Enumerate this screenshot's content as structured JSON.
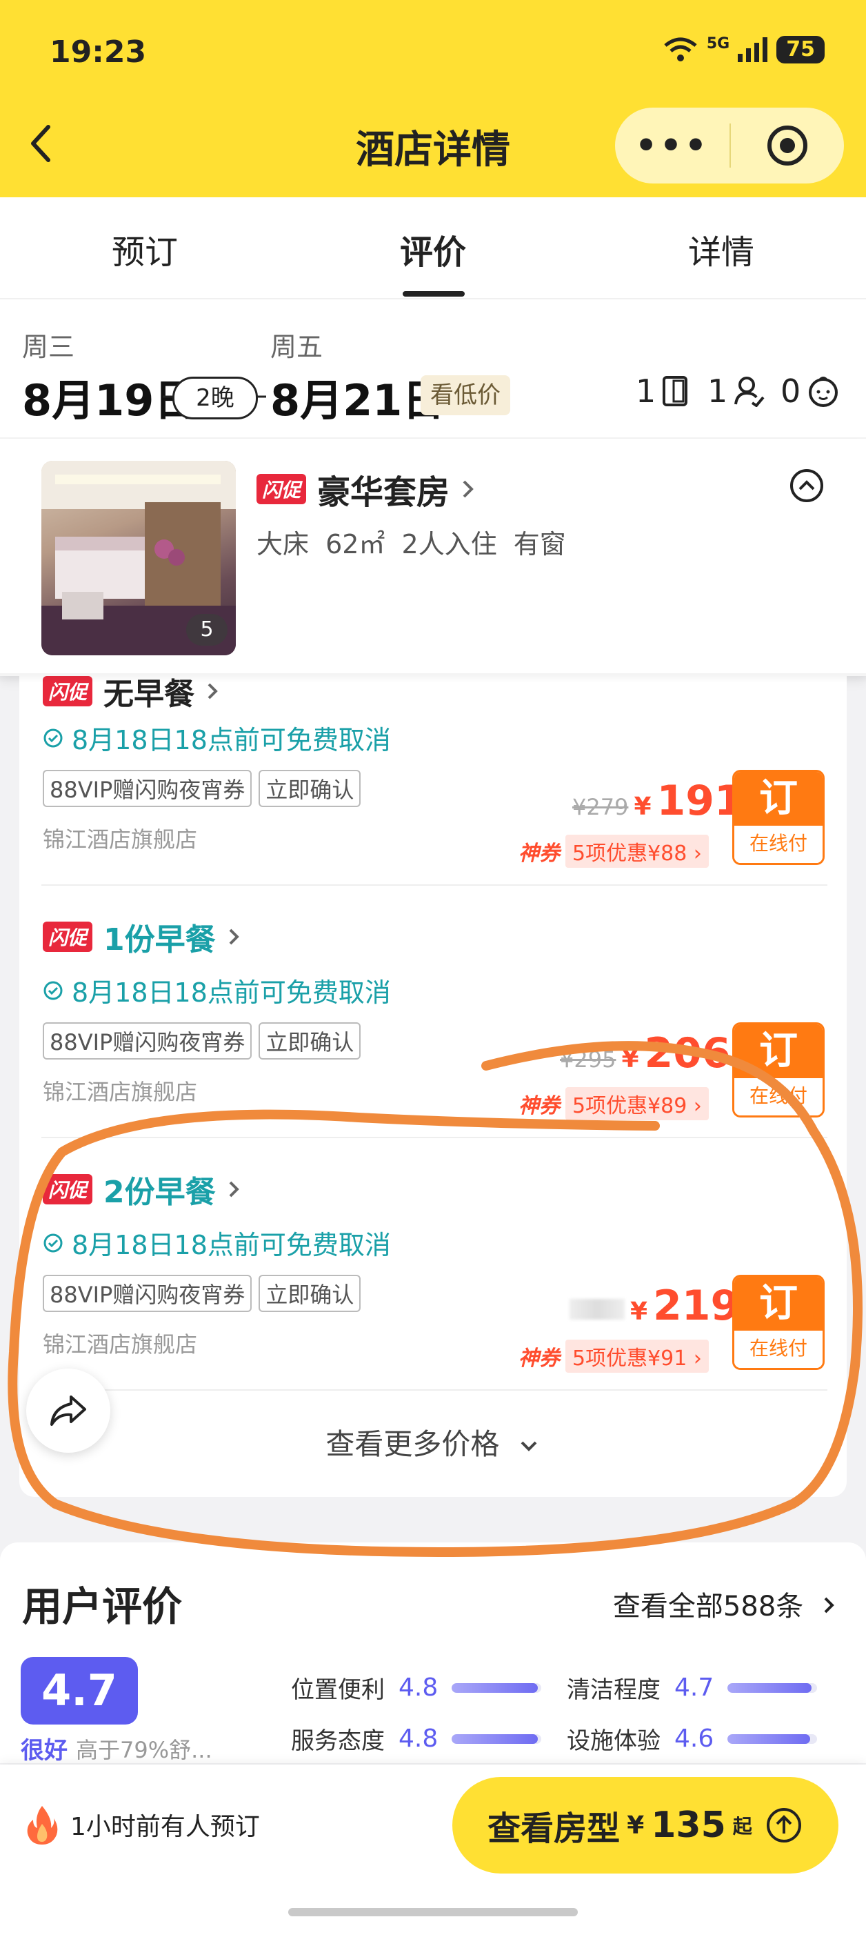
{
  "status": {
    "time": "19:23",
    "network": "5G",
    "battery": "75"
  },
  "nav": {
    "title": "酒店详情",
    "more": "•••"
  },
  "tabs": [
    {
      "label": "预订"
    },
    {
      "label": "评价"
    },
    {
      "label": "详情"
    }
  ],
  "dates": {
    "checkin_weekday": "周三",
    "checkin_date": "8月19日",
    "nights": "2晚",
    "checkout_weekday": "周五",
    "checkout_date": "8月21日",
    "low_price": "看低价",
    "rooms": "1",
    "adults": "1",
    "children": "0"
  },
  "room": {
    "flash": "闪促",
    "name": "豪华套房",
    "attrs": "大床 62㎡ 2人入住 有窗",
    "photo_count": "5"
  },
  "rates": [
    {
      "flash": "闪促",
      "title": "无早餐",
      "cancel": "8月18日18点前可免费取消",
      "chips": [
        "88VIP赠闪购夜宵券",
        "立即确认"
      ],
      "store": "锦江酒店旗舰店",
      "orig": "¥279",
      "yen": "¥",
      "price": "191",
      "god": "神券",
      "deal": "5项优惠¥88 ›",
      "book": "订",
      "pay": "在线付"
    },
    {
      "flash": "闪促",
      "title": "1份早餐",
      "cancel": "8月18日18点前可免费取消",
      "chips": [
        "88VIP赠闪购夜宵券",
        "立即确认"
      ],
      "store": "锦江酒店旗舰店",
      "orig": "¥295",
      "yen": "¥",
      "price": "206",
      "god": "神券",
      "deal": "5项优惠¥89 ›",
      "book": "订",
      "pay": "在线付"
    },
    {
      "flash": "闪促",
      "title": "2份早餐",
      "cancel": "8月18日18点前可免费取消",
      "chips": [
        "88VIP赠闪购夜宵券",
        "立即确认"
      ],
      "store": "锦江酒店旗舰店",
      "orig": "",
      "yen": "¥",
      "price": "219",
      "god": "神券",
      "deal": "5项优惠¥91 ›",
      "book": "订",
      "pay": "在线付"
    }
  ],
  "more_prices": "查看更多价格",
  "reviews": {
    "title": "用户评价",
    "view_all": "查看全部588条",
    "score": "4.7",
    "score_word": "很好",
    "compare": "高于79%舒...",
    "metrics": [
      {
        "label": "位置便利",
        "value": "4.8",
        "fill": 0.96
      },
      {
        "label": "清洁程度",
        "value": "4.7",
        "fill": 0.94
      },
      {
        "label": "服务态度",
        "value": "4.8",
        "fill": 0.96
      },
      {
        "label": "设施体验",
        "value": "4.6",
        "fill": 0.92
      }
    ]
  },
  "bottom": {
    "recent": "1小时前有人预订",
    "cta_label": "查看房型",
    "cta_yen": "¥",
    "cta_price": "135",
    "cta_from": "起"
  },
  "colors": {
    "brand_yellow": "#ffe033",
    "price_red": "#ff4d2e",
    "teal": "#1aa0a8",
    "score_purple": "#5d5cf0",
    "book_orange": "#ff7a12",
    "annotation_orange": "#f08a3c"
  }
}
